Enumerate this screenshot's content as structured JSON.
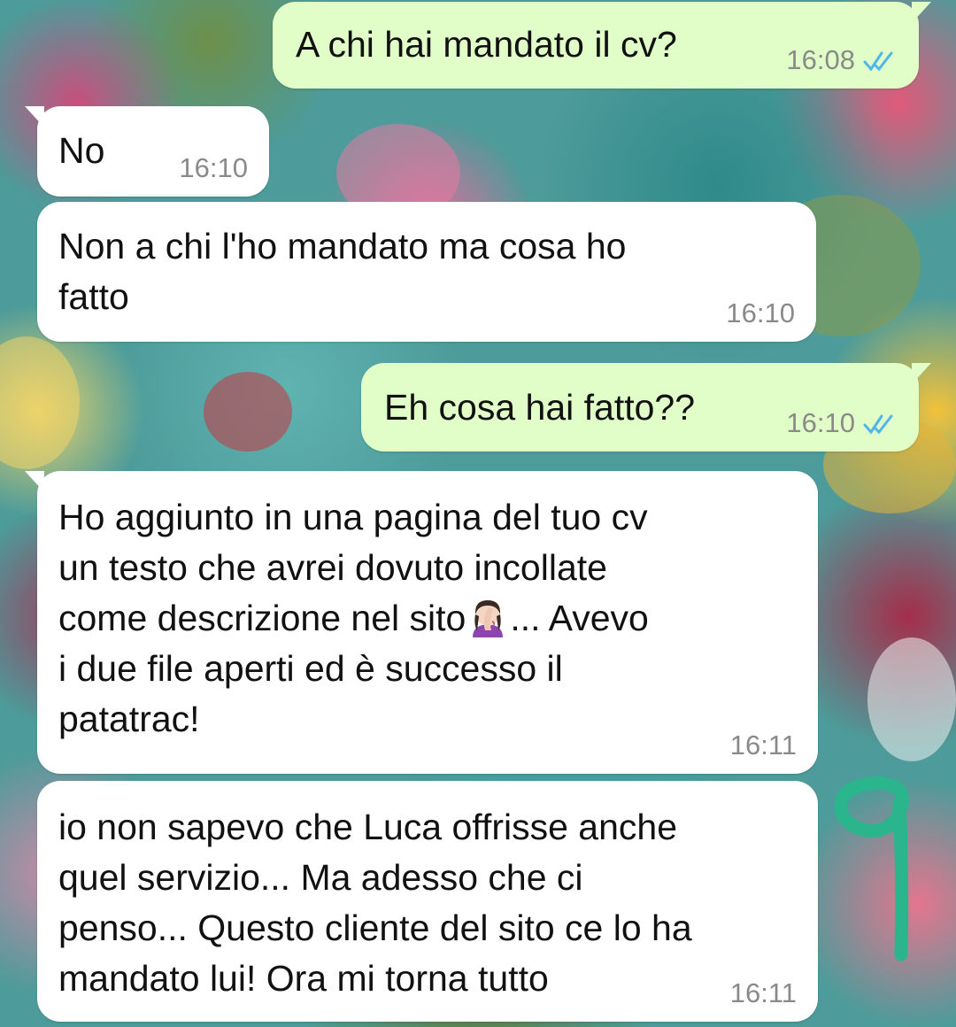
{
  "messages": [
    {
      "direction": "out",
      "text": "A chi hai mandato il cv?",
      "time": "16:08",
      "status": "read-double-check-icon"
    },
    {
      "direction": "in",
      "text": "No",
      "time": "16:10"
    },
    {
      "direction": "in",
      "lines": [
        "Non a chi l'ho mandato ma cosa ho",
        "fatto"
      ],
      "time": "16:10"
    },
    {
      "direction": "out",
      "text": "Eh cosa hai fatto??",
      "time": "16:10",
      "status": "read-double-check-icon"
    },
    {
      "direction": "in",
      "lines": [
        "Ho aggiunto in una pagina del tuo cv",
        "un testo che avrei dovuto incollate",
        "come descrizione nel sito",
        "... Avevo",
        "i due file aperti ed è successo il",
        "patatrac!"
      ],
      "emoji": "woman-facepalming-icon",
      "time": "16:11"
    },
    {
      "direction": "in",
      "lines": [
        "io non sapevo che Luca offrisse anche",
        "quel servizio... Ma adesso che ci",
        "penso... Questo cliente del sito ce lo ha",
        "mandato lui! Ora mi torna tutto"
      ],
      "time": "16:11"
    }
  ],
  "colors": {
    "incoming_bubble": "#ffffff",
    "outgoing_bubble": "#e1fec9",
    "tick_blue": "#4fb6ec",
    "timestamp": "#8a8a8a",
    "doodle": "#2bb58c"
  }
}
